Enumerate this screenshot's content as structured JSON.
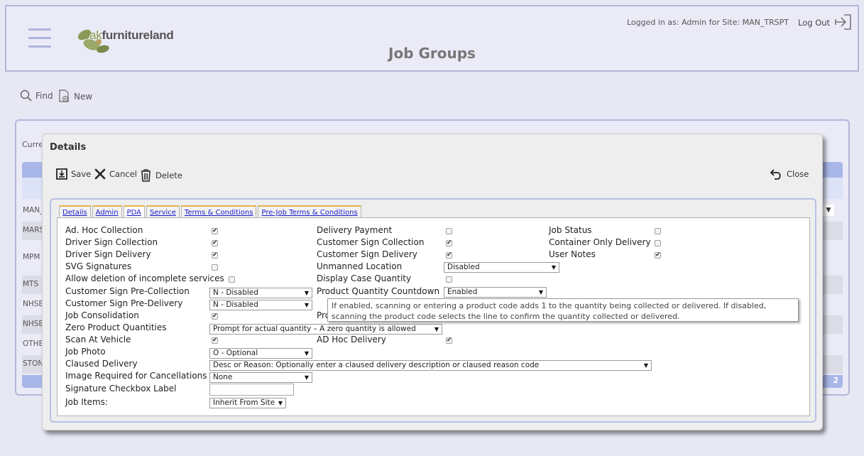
{
  "header": {
    "brand_prefix": "oak",
    "brand_rest": "furnitureland",
    "logged_in": "Logged in as: Admin for Site: MAN_TRSPT",
    "logout": "Log Out",
    "title": "Job Groups"
  },
  "toolbar": {
    "find": "Find",
    "new": "New"
  },
  "background": {
    "curr_label": "Curre",
    "rows": [
      "MAN_",
      "MARS",
      "MPM",
      "MTS",
      "NHSB",
      "NHSB",
      "OTHE",
      "STON"
    ],
    "page": "2"
  },
  "dialog": {
    "title": "Details",
    "save": "Save",
    "cancel": "Cancel",
    "delete": "Delete",
    "close": "Close",
    "tabs": [
      "Details",
      "Admin",
      "PDA",
      "Service",
      "Terms & Conditions",
      "Pre-Job Terms & Conditions"
    ],
    "fields": {
      "ad_hoc_collection": "Ad. Hoc Collection",
      "driver_sign_collection": "Driver Sign Collection",
      "driver_sign_delivery": "Driver Sign Delivery",
      "svg_signatures": "SVG Signatures",
      "allow_deletion": "Allow deletion of incomplete services",
      "customer_sign_pre_collection": "Customer Sign Pre-Collection",
      "customer_sign_pre_collection_value": "N - Disabled",
      "customer_sign_pre_delivery": "Customer Sign Pre-Delivery",
      "customer_sign_pre_delivery_value": "N - Disabled",
      "job_consolidation": "Job Consolidation",
      "zero_product_quantities": "Zero Product Quantities",
      "zero_product_quantities_value": "Prompt for actual quantity – A zero quantity is allowed",
      "scan_at_vehicle": "Scan At Vehicle",
      "job_photo": "Job Photo",
      "job_photo_value": "O - Optional",
      "claused_delivery": "Claused Delivery",
      "claused_delivery_value": "Desc or Reason: Optionally enter a claused delivery description or claused reason code",
      "image_required_cancellations": "Image Required for Cancellations",
      "image_required_cancellations_value": "None",
      "signature_checkbox_label": "Signature Checkbox Label",
      "signature_checkbox_label_value": "",
      "job_items": "Job Items:",
      "job_items_value": "Inherit From Site",
      "delivery_payment": "Delivery Payment",
      "customer_sign_collection": "Customer Sign Collection",
      "customer_sign_delivery": "Customer Sign Delivery",
      "unmanned_location": "Unmanned Location",
      "unmanned_location_value": "Disabled",
      "display_case_quantity": "Display Case Quantity",
      "product_quantity_countdown": "Product Quantity Countdown",
      "product_quantity_countdown_value": "Enabled",
      "hidden_pro": "Pro",
      "ad_hoc_delivery": "AD Hoc Delivery",
      "job_status": "Job Status",
      "container_only_delivery": "Container Only Delivery",
      "user_notes": "User Notes"
    },
    "checks": {
      "ad_hoc_collection": true,
      "driver_sign_collection": true,
      "driver_sign_delivery": true,
      "svg_signatures": false,
      "allow_deletion": false,
      "job_consolidation": true,
      "scan_at_vehicle": true,
      "delivery_payment": false,
      "customer_sign_collection": true,
      "customer_sign_delivery": true,
      "display_case_quantity": false,
      "ad_hoc_delivery": true,
      "job_status": false,
      "container_only_delivery": false,
      "user_notes": true
    },
    "tooltip": "If enabled, scanning or entering a product code adds 1 to the quantity being collected or delivered. If disabled, scanning the product code selects the line to confirm the quantity collected or delivered."
  },
  "colors": {
    "accent_blue": "#a9b6e8",
    "tab_link": "#1a1ad0",
    "header_border": "#b4b6d8"
  }
}
